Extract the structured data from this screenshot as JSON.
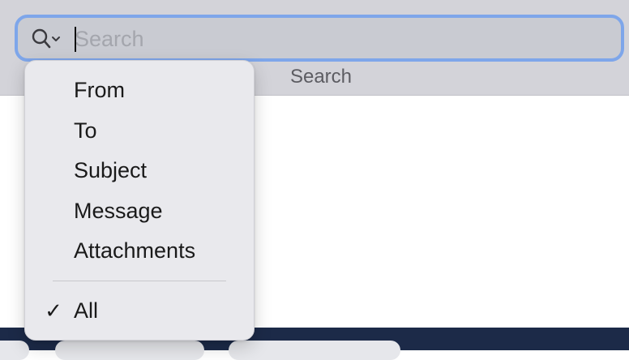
{
  "search": {
    "placeholder": "Search",
    "value": "",
    "label": "Search",
    "focus_color": "#7ea6ea"
  },
  "search_menu": {
    "items": [
      {
        "label": "From",
        "checked": false
      },
      {
        "label": "To",
        "checked": false
      },
      {
        "label": "Subject",
        "checked": false
      },
      {
        "label": "Message",
        "checked": false
      },
      {
        "label": "Attachments",
        "checked": false
      }
    ],
    "all": {
      "label": "All",
      "checked": true,
      "check_glyph": "✓"
    }
  },
  "icons": {
    "search_scope": "magnifier-with-chevron-icon",
    "checkmark": "checkmark-icon"
  },
  "colors": {
    "toolbar_bg": "#d3d3d9",
    "bottom_bar": "#1c2a48",
    "menu_bg": "#e9e9ed"
  }
}
